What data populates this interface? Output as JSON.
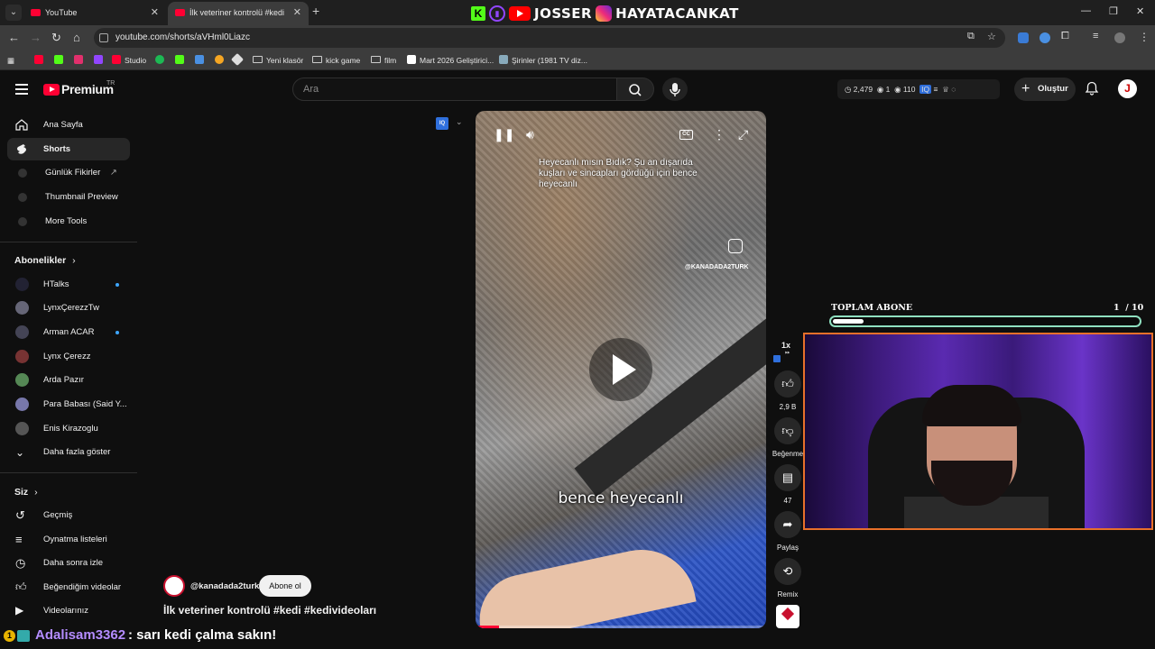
{
  "browser": {
    "tabs": [
      {
        "title": "YouTube"
      },
      {
        "title": "İlk veteriner kontrolü #kedi"
      }
    ],
    "url": "youtube.com/shorts/aVHml0Liazc",
    "bookmarks": [
      "Studio",
      "Yeni klasör",
      "kick game",
      "film",
      "Mart 2026 Geliştirici...",
      "Şirinler (1981 TV diz..."
    ]
  },
  "stream_overlay": {
    "brand_text_1": "JOSSER",
    "brand_text_2": "HAYATACANKAT",
    "goal_label": "TOPLAM ABONE",
    "goal_current": "1",
    "goal_total": "/ 10",
    "goal_progress": 0.1,
    "chat": {
      "user": "Adalisam3362",
      "message": ": sarı kedi çalma sakın!"
    }
  },
  "header": {
    "logo_text": "Premium",
    "region": "TR",
    "search_placeholder": "Ara",
    "stats": {
      "views": "2,479",
      "a": "1",
      "b": "110"
    },
    "create_label": "Oluştur",
    "avatar_letter": "J"
  },
  "sidebar": {
    "main": [
      "Ana Sayfa",
      "Shorts",
      "Günlük Fikirler",
      "Thumbnail Preview",
      "More Tools"
    ],
    "subscriptions_title": "Abonelikler",
    "subscriptions": [
      "HTalks",
      "LynxÇerezzTw",
      "Arman ACAR",
      "Lynx Çerezz",
      "Arda Pazır",
      "Para Babası (Said Y...",
      "Enis Kirazoglu"
    ],
    "show_more": "Daha fazla göster",
    "you_title": "Siz",
    "you": [
      "Geçmiş",
      "Oynatma listeleri",
      "Daha sonra izle",
      "Beğendiğim videolar",
      "Videolarınız"
    ]
  },
  "short": {
    "caption_top": "Heyecanlı mısın Bıdık? Şu an dışarıda kuşları ve sincapları gördüğü için bence heyecanlı",
    "handle_watermark": "@KANADADA2TURK",
    "caption_mid": "bence heyecanlı",
    "channel": "@kanadada2turk",
    "subscribe": "Abone ol",
    "title": "İlk veteriner kontrolü #kedi #kedivideoları",
    "progress": 0.08,
    "speed": "1x",
    "likes": "2,9 B",
    "dislike_label": "Beğenme",
    "comments": "47",
    "share_label": "Paylaş",
    "remix_label": "Remix"
  }
}
